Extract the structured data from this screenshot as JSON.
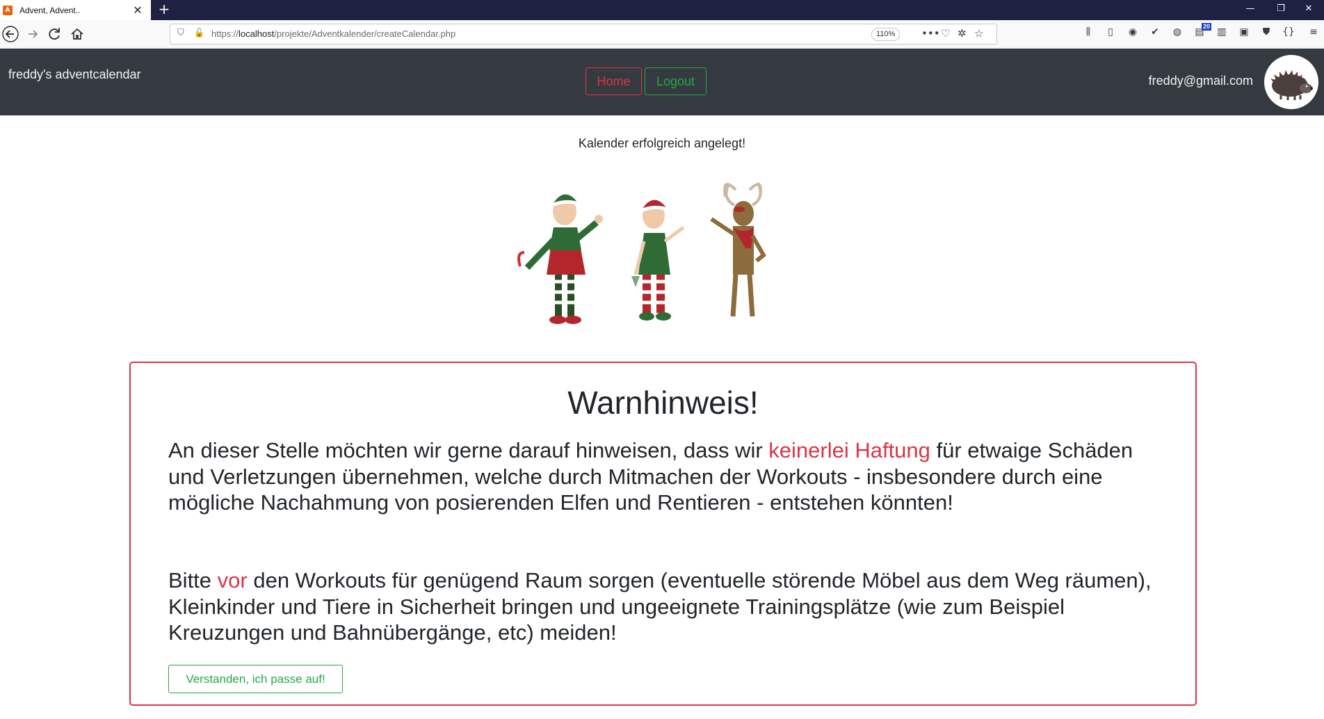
{
  "browser": {
    "tab_title": "Advent, Advent..",
    "tab_close": "✕",
    "new_tab": "+",
    "url_prefix": "https://",
    "url_host": "localhost",
    "url_path": "/projekte/Adventkalender/createCalendar.php",
    "zoom": "110%",
    "addon_badge_count": "20",
    "window_controls": [
      "—",
      "❐",
      "✕"
    ]
  },
  "navbar": {
    "brand": "freddy's adventcalendar",
    "home_label": "Home",
    "logout_label": "Logout",
    "user_email": "freddy@gmail.com"
  },
  "content": {
    "success_message": "Kalender erfolgreich angelegt!"
  },
  "warning": {
    "title": "Warnhinweis!",
    "p1_start": "An dieser Stelle möchten wir gerne darauf hinweisen, dass wir ",
    "p1_highlight": "keinerlei Haftung",
    "p1_end": " für etwaige Schäden und Verletzungen übernehmen, welche durch Mitmachen der Workouts - insbesondere durch eine mögliche Nachahmung von posierenden Elfen und Rentieren - entstehen könnten!",
    "p2_start": "Bitte ",
    "p2_highlight": "vor",
    "p2_end": " den Workouts für genügend Raum sorgen (eventuelle störende Möbel aus dem Weg räumen), Kleinkinder und Tiere in Sicherheit bringen und ungeeignete Trainingsplätze (wie zum Beispiel Kreuzungen und Bahnübergänge, etc) meiden!",
    "confirm_label": "Verstanden, ich passe auf!"
  },
  "colors": {
    "navbar_bg": "#343a40",
    "danger": "#dc3545",
    "success": "#28a745"
  }
}
